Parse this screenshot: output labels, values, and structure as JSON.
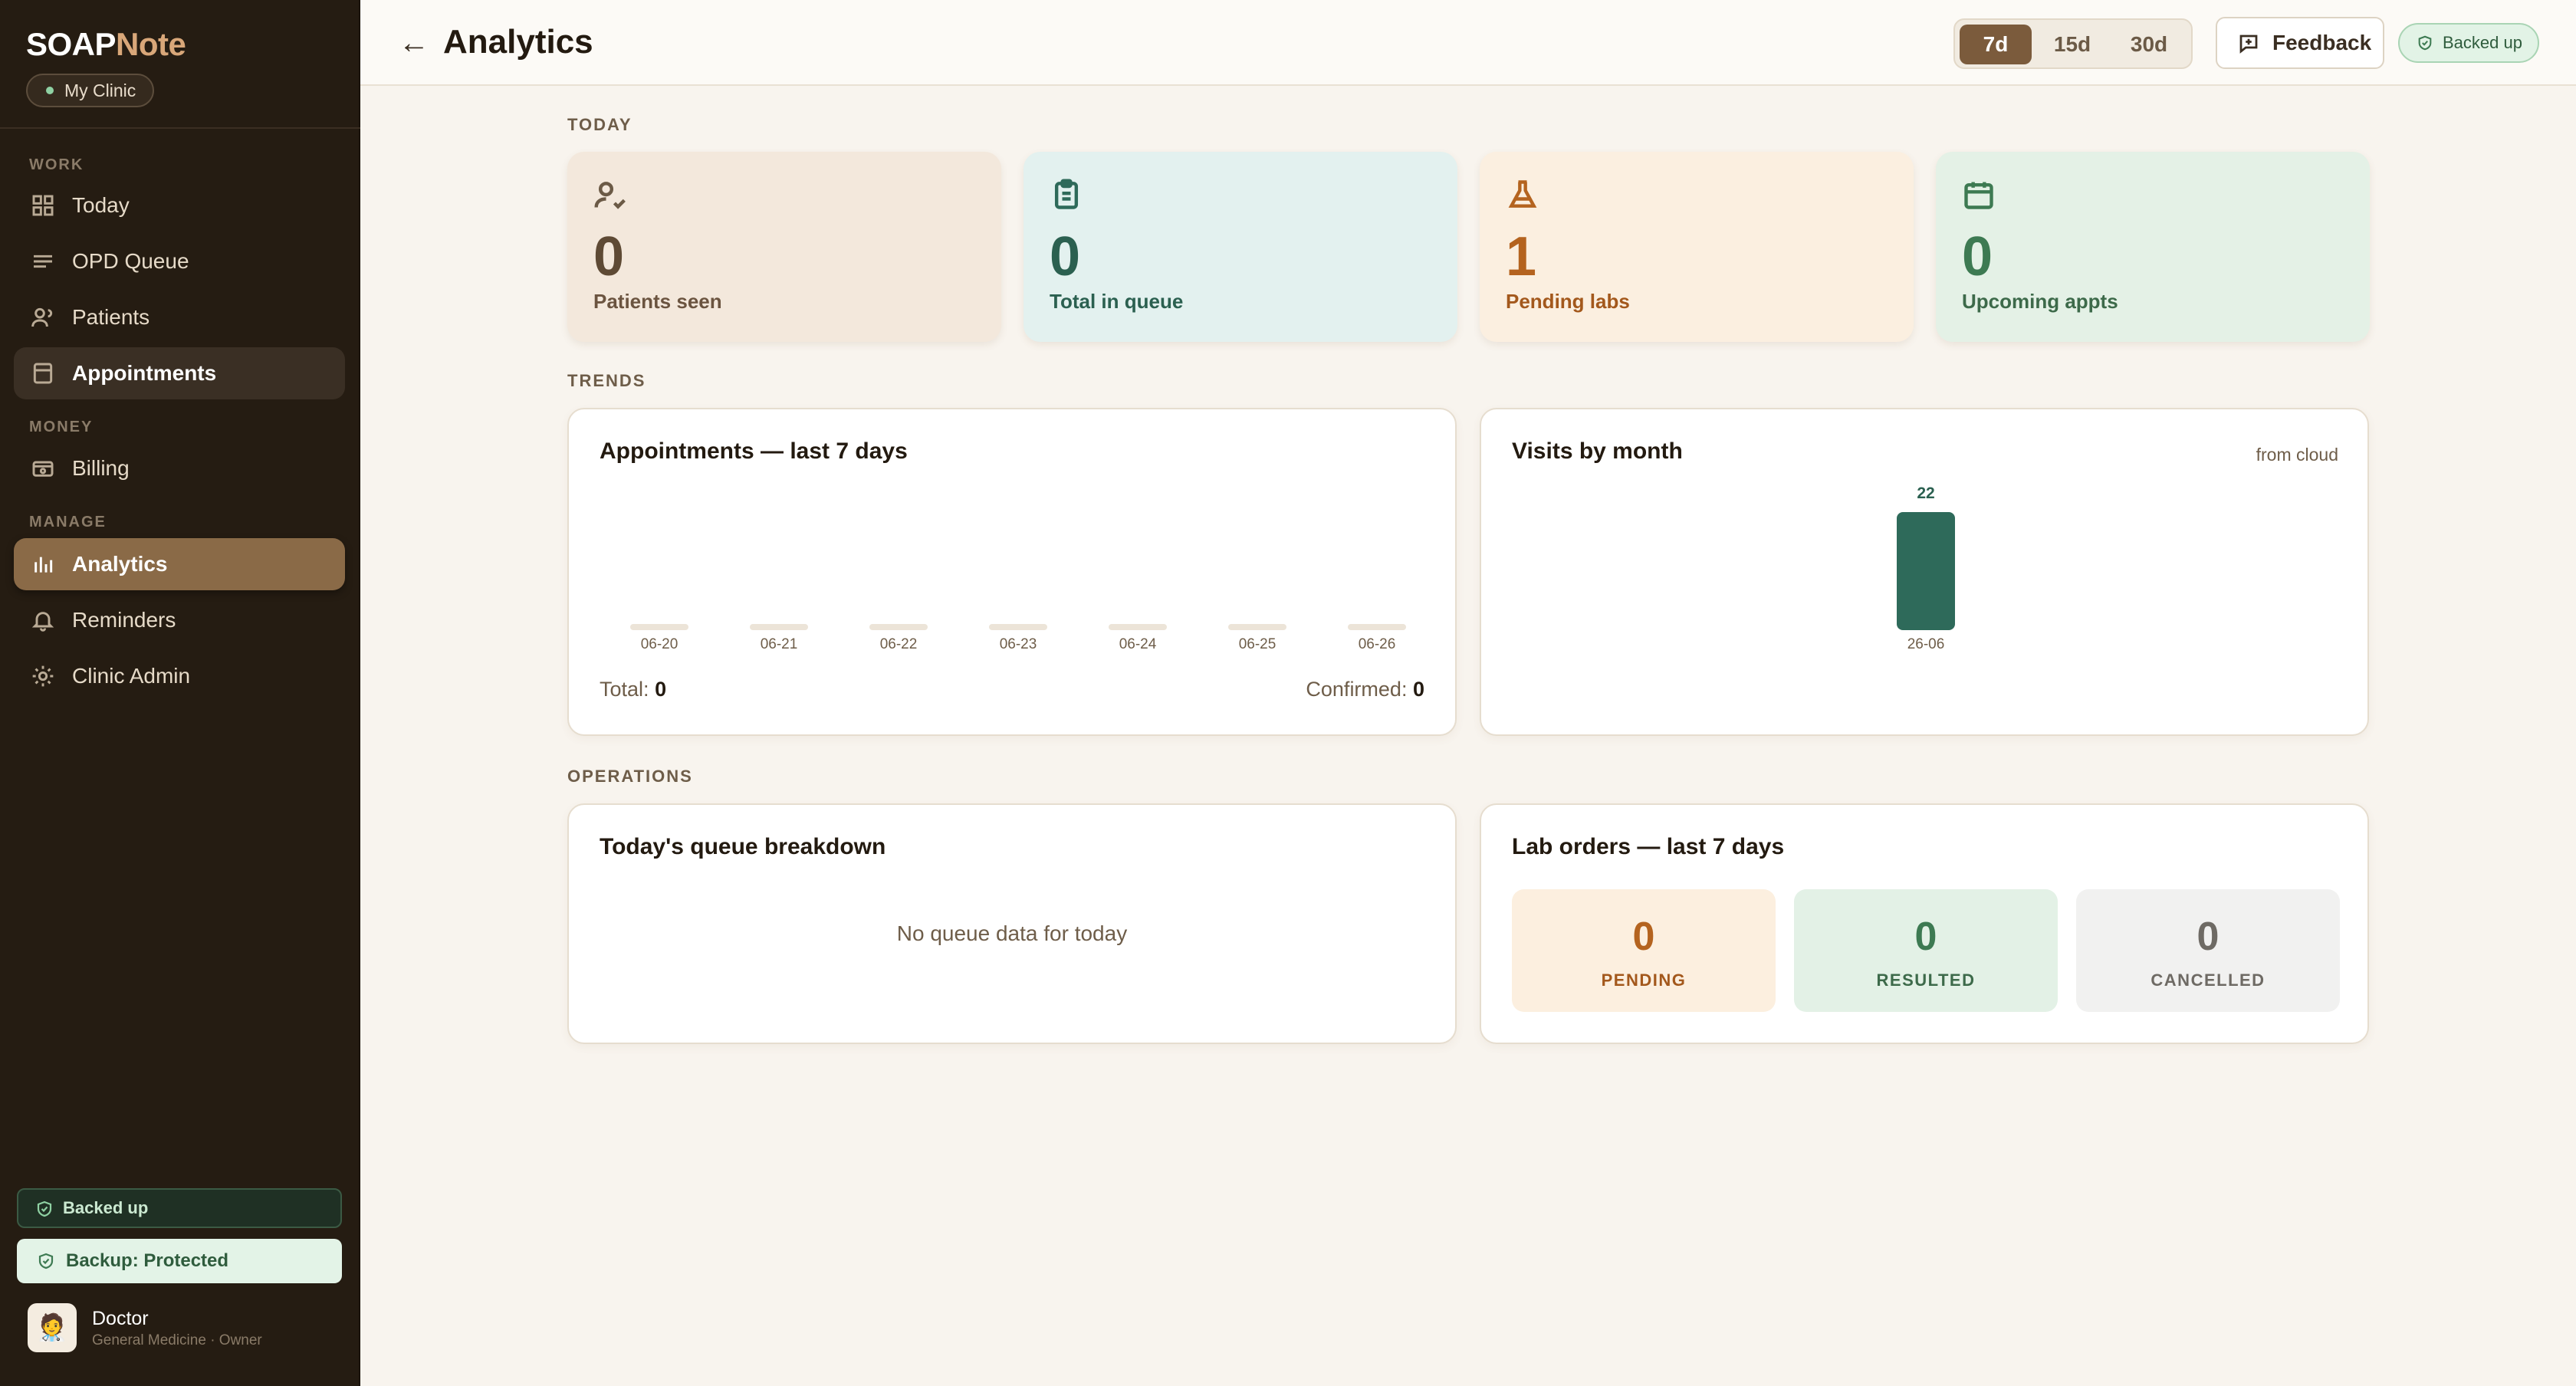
{
  "sidebar": {
    "brand_main": "SOAP",
    "brand_accent": "Note",
    "clinic": "My Clinic",
    "sections": {
      "work": "WORK",
      "money": "MONEY",
      "manage": "MANAGE"
    },
    "items": {
      "today": "Today",
      "opd_queue": "OPD Queue",
      "patients": "Patients",
      "appointments": "Appointments",
      "billing": "Billing",
      "analytics": "Analytics",
      "reminders": "Reminders",
      "clinic_admin": "Clinic Admin"
    },
    "backed_up": "Backed up",
    "backup_protected": "Backup: Protected",
    "user": {
      "name": "Doctor",
      "role": "General Medicine · Owner",
      "avatar": "🧑‍⚕️"
    }
  },
  "header": {
    "back": "←",
    "title": "Analytics",
    "ranges": [
      "7d",
      "15d",
      "30d"
    ],
    "selected_range": "7d",
    "feedback": "Feedback",
    "backed_up": "Backed up"
  },
  "sections": {
    "today": "TODAY",
    "trends": "TRENDS",
    "operations": "OPERATIONS"
  },
  "kpis": {
    "patients_seen": {
      "value": "0",
      "label": "Patients seen"
    },
    "total_in_queue": {
      "value": "0",
      "label": "Total in queue"
    },
    "pending_labs": {
      "value": "1",
      "label": "Pending labs"
    },
    "upcoming_appts": {
      "value": "0",
      "label": "Upcoming appts"
    }
  },
  "appointments_chart": {
    "title": "Appointments — last 7 days",
    "total_label": "Total:",
    "total_value": "0",
    "confirmed_label": "Confirmed:",
    "confirmed_value": "0"
  },
  "visits_chart": {
    "title": "Visits by month",
    "source": "from cloud"
  },
  "queue_breakdown": {
    "title": "Today's queue breakdown",
    "empty": "No queue data for today"
  },
  "lab_orders": {
    "title": "Lab orders — last 7 days",
    "pending": {
      "value": "0",
      "label": "PENDING"
    },
    "resulted": {
      "value": "0",
      "label": "RESULTED"
    },
    "cancelled": {
      "value": "0",
      "label": "CANCELLED"
    }
  },
  "colors": {
    "sidebar_bg": "#251c12",
    "accent_brown": "#8a6a47",
    "teal": "#2e6a5a",
    "orange": "#b4631f",
    "green": "#3d7a52"
  },
  "chart_data": [
    {
      "type": "bar",
      "title": "Appointments — last 7 days",
      "categories": [
        "06-20",
        "06-21",
        "06-22",
        "06-23",
        "06-24",
        "06-25",
        "06-26"
      ],
      "values": [
        0,
        0,
        0,
        0,
        0,
        0,
        0
      ]
    },
    {
      "type": "bar",
      "title": "Visits by month",
      "categories": [
        "26-06"
      ],
      "values": [
        22
      ]
    }
  ]
}
